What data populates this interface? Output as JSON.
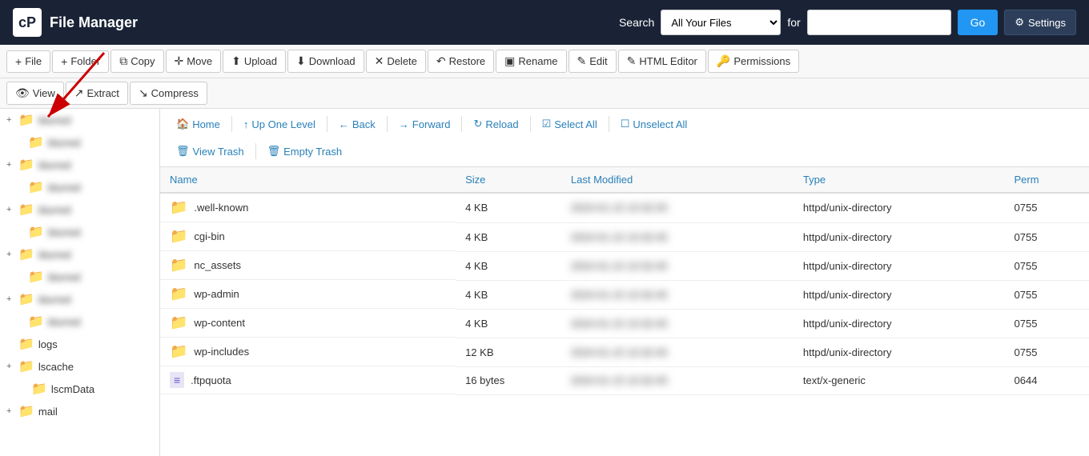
{
  "header": {
    "title": "File Manager",
    "search_label": "Search",
    "search_placeholder": "",
    "for_label": "for",
    "go_label": "Go",
    "settings_label": "Settings",
    "search_options": [
      "All Your Files"
    ]
  },
  "toolbar": {
    "row1": [
      {
        "id": "new-file",
        "icon": "+",
        "label": "File"
      },
      {
        "id": "new-folder",
        "icon": "+",
        "label": "Folder"
      },
      {
        "id": "copy",
        "icon": "⧉",
        "label": "Copy"
      },
      {
        "id": "move",
        "icon": "✛",
        "label": "Move"
      },
      {
        "id": "upload",
        "icon": "⬆",
        "label": "Upload"
      },
      {
        "id": "download",
        "icon": "⬇",
        "label": "Download"
      },
      {
        "id": "delete",
        "icon": "✕",
        "label": "Delete"
      },
      {
        "id": "restore",
        "icon": "↶",
        "label": "Restore"
      },
      {
        "id": "rename",
        "icon": "▣",
        "label": "Rename"
      },
      {
        "id": "edit",
        "icon": "✎",
        "label": "Edit"
      },
      {
        "id": "html-editor",
        "icon": "✎",
        "label": "HTML Editor"
      },
      {
        "id": "permissions",
        "icon": "🔑",
        "label": "Permissions"
      }
    ],
    "row2": [
      {
        "id": "view",
        "icon": "👁",
        "label": "View"
      },
      {
        "id": "extract",
        "icon": "↗",
        "label": "Extract"
      },
      {
        "id": "compress",
        "icon": "↘",
        "label": "Compress"
      }
    ]
  },
  "nav": {
    "home": "Home",
    "up_one_level": "Up One Level",
    "back": "Back",
    "forward": "Forward",
    "reload": "Reload",
    "select_all": "Select All",
    "unselect_all": "Unselect All",
    "view_trash": "View Trash",
    "empty_trash": "Empty Trash"
  },
  "table": {
    "headers": [
      "Name",
      "Size",
      "Last Modified",
      "Type",
      "Perm"
    ],
    "rows": [
      {
        "name": ".well-known",
        "size": "4 KB",
        "modified": "",
        "type": "httpd/unix-directory",
        "perm": "0755",
        "is_folder": true
      },
      {
        "name": "cgi-bin",
        "size": "4 KB",
        "modified": "",
        "type": "httpd/unix-directory",
        "perm": "0755",
        "is_folder": true
      },
      {
        "name": "nc_assets",
        "size": "4 KB",
        "modified": "",
        "type": "httpd/unix-directory",
        "perm": "0755",
        "is_folder": true
      },
      {
        "name": "wp-admin",
        "size": "4 KB",
        "modified": "",
        "type": "httpd/unix-directory",
        "perm": "0755",
        "is_folder": true
      },
      {
        "name": "wp-content",
        "size": "4 KB",
        "modified": "",
        "type": "httpd/unix-directory",
        "perm": "0755",
        "is_folder": true
      },
      {
        "name": "wp-includes",
        "size": "12 KB",
        "modified": "",
        "type": "httpd/unix-directory",
        "perm": "0755",
        "is_folder": true
      },
      {
        "name": ".ftpquota",
        "size": "16 bytes",
        "modified": "",
        "type": "text/x-generic",
        "perm": "0644",
        "is_folder": false
      }
    ]
  },
  "sidebar": {
    "items": [
      {
        "label": "",
        "indent": 0,
        "has_expand": true,
        "blurred": true
      },
      {
        "label": "",
        "indent": 1,
        "has_expand": false,
        "blurred": true
      },
      {
        "label": "",
        "indent": 0,
        "has_expand": true,
        "blurred": true
      },
      {
        "label": "",
        "indent": 1,
        "has_expand": false,
        "blurred": true
      },
      {
        "label": "",
        "indent": 0,
        "has_expand": true,
        "blurred": true
      },
      {
        "label": "",
        "indent": 1,
        "has_expand": false,
        "blurred": true
      },
      {
        "label": "",
        "indent": 0,
        "has_expand": true,
        "blurred": true
      },
      {
        "label": "",
        "indent": 1,
        "has_expand": false,
        "blurred": true
      },
      {
        "label": "",
        "indent": 0,
        "has_expand": true,
        "blurred": true
      },
      {
        "label": "",
        "indent": 1,
        "has_expand": false,
        "blurred": true
      },
      {
        "label": "logs",
        "indent": 0,
        "has_expand": false,
        "blurred": false
      },
      {
        "label": "lscache",
        "indent": 0,
        "has_expand": true,
        "blurred": false
      },
      {
        "label": "lscmData",
        "indent": 1,
        "has_expand": false,
        "blurred": false
      },
      {
        "label": "mail",
        "indent": 0,
        "has_expand": true,
        "blurred": false
      }
    ]
  },
  "arrow": {
    "visible": true
  }
}
